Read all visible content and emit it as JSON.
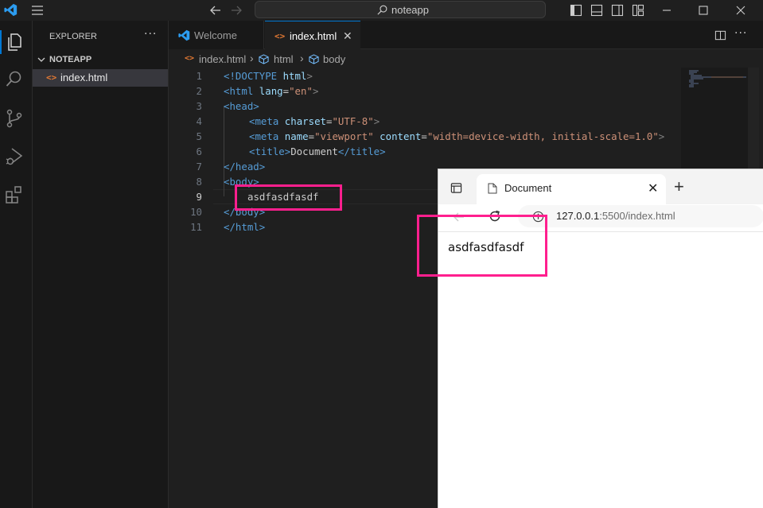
{
  "titlebar": {
    "search_label": "noteapp"
  },
  "sidebar": {
    "title": "EXPLORER",
    "more": "···",
    "folder": "NOTEAPP",
    "files": [
      {
        "name": "index.html"
      }
    ]
  },
  "tabs": [
    {
      "label": "Welcome",
      "active": false
    },
    {
      "label": "index.html",
      "active": true
    }
  ],
  "breadcrumb": {
    "file": "index.html",
    "sep": "›",
    "items": [
      "html",
      "body"
    ]
  },
  "editor": {
    "active_line": 9,
    "lines": [
      {
        "n": "1"
      },
      {
        "n": "2"
      },
      {
        "n": "3"
      },
      {
        "n": "4"
      },
      {
        "n": "5"
      },
      {
        "n": "6"
      },
      {
        "n": "7"
      },
      {
        "n": "8"
      },
      {
        "n": "9"
      },
      {
        "n": "10"
      },
      {
        "n": "11"
      }
    ],
    "code": {
      "l1_decl": "<!DOCTYPE",
      "l1_word": " html",
      "l1_end": ">",
      "l2_tag": "<html",
      "l2_attr": " lang",
      "l2_eq": "=",
      "l2_val": "\"en\"",
      "l2_end": ">",
      "l3": "<head>",
      "l4_tag": "<meta",
      "l4_attr": " charset",
      "l4_eq": "=",
      "l4_val": "\"UTF-8\"",
      "l4_end": ">",
      "l5_tag": "<meta",
      "l5_attr1": " name",
      "l5_eq1": "=",
      "l5_val1": "\"viewport\"",
      "l5_attr2": " content",
      "l5_eq2": "=",
      "l5_val2": "\"width=device-width, initial-scale=1.0\"",
      "l5_end": ">",
      "l6_open": "<title>",
      "l6_text": "Document",
      "l6_close": "</title>",
      "l7": "</head>",
      "l8": "<body>",
      "l9_text": "asdfasdfasdf",
      "l10": "</body>",
      "l11": "</html>"
    }
  },
  "browser": {
    "tab_title": "Document",
    "tab_close": "✕",
    "new_tab": "+",
    "url_host": "127.0.0.1",
    "url_rest": ":5500/index.html",
    "content_text": "asdfasdfasdf"
  },
  "colors": {
    "highlight": "#ff1f8e",
    "vscode_blue": "#0078d4",
    "html_icon": "#e37933"
  },
  "icons": [
    "vscode-logo-icon",
    "menu-icon",
    "back-icon",
    "forward-icon",
    "search-icon",
    "toggle-sidebar-icon",
    "toggle-panel-icon",
    "toggle-secondary-sidebar-icon",
    "customize-layout-icon",
    "minimize-icon",
    "maximize-icon",
    "close-icon",
    "explorer-icon",
    "search-activity-icon",
    "source-control-icon",
    "run-debug-icon",
    "extensions-icon",
    "split-editor-icon",
    "html-file-icon",
    "info-icon",
    "reload-icon"
  ]
}
